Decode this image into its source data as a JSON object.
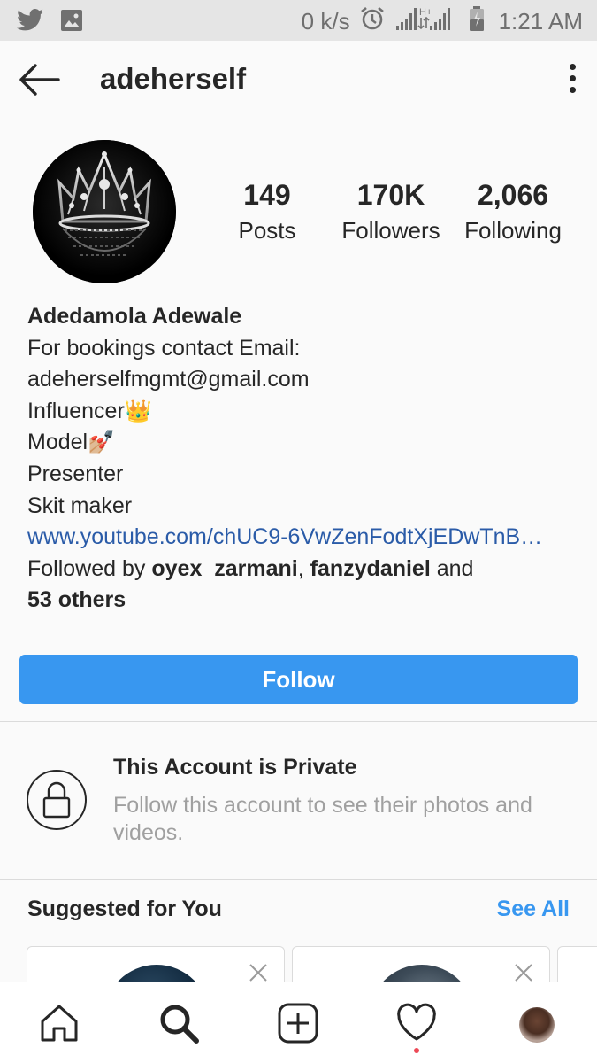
{
  "status_bar": {
    "speed": "0 k/s",
    "time": "1:21 AM",
    "icons": [
      "twitter-icon",
      "image-icon",
      "alarm-icon",
      "signal-icon",
      "battery-icon"
    ]
  },
  "header": {
    "username": "adeherself",
    "back_icon": "arrow-left-icon",
    "more_icon": "more-vertical-icon"
  },
  "profile": {
    "stats": [
      {
        "value": "149",
        "label": "Posts"
      },
      {
        "value": "170K",
        "label": "Followers"
      },
      {
        "value": "2,066",
        "label": "Following"
      }
    ],
    "name": "Adedamola Adewale",
    "bio_lines": [
      "For bookings contact Email:",
      "adeherselfmgmt@gmail.com",
      "Influencer👑",
      "Model💅🏼",
      "Presenter",
      "Skit maker"
    ],
    "link": "www.youtube.com/chUC9-6VwZenFodtXjEDwTnB…",
    "followed_by_prefix": "Followed by ",
    "followed_by_users": [
      "oyex_zarmani",
      "fanzydaniel"
    ],
    "followed_by_sep": ", ",
    "followed_by_and": " and",
    "followed_by_others": "53 others"
  },
  "follow_button": {
    "label": "Follow"
  },
  "private_notice": {
    "title": "This Account is Private",
    "subtitle": "Follow this account to see their photos and videos."
  },
  "suggestions": {
    "title": "Suggested for You",
    "see_all": "See All"
  },
  "bottom_nav": {
    "items": [
      "home-icon",
      "search-icon",
      "add-post-icon",
      "activity-icon",
      "profile-icon"
    ]
  },
  "colors": {
    "accent": "#3897f0",
    "link": "#2a5ba8",
    "status_bar": "#e5e5e5",
    "notification_dot": "#ed4956"
  }
}
